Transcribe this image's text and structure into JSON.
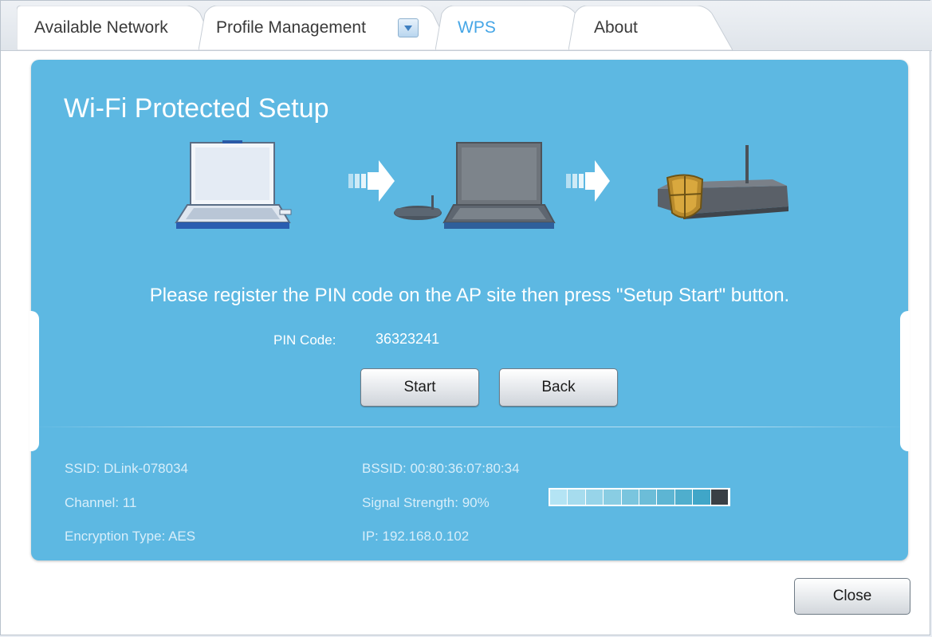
{
  "tabs": [
    {
      "label": "Available Network",
      "active": false
    },
    {
      "label": "Profile Management",
      "active": false
    },
    {
      "label": "WPS",
      "active": true
    },
    {
      "label": "About",
      "active": false
    }
  ],
  "panel": {
    "title": "Wi-Fi Protected Setup",
    "instruction": "Please register the PIN code on the AP site then press \"Setup Start\" button.",
    "pin_label": "PIN Code:",
    "pin_value": "36323241",
    "start_label": "Start",
    "back_label": "Back"
  },
  "status": {
    "ssid": "SSID: DLink-078034",
    "channel": "Channel: 11",
    "encryption": "Encryption Type: AES",
    "bssid": "BSSID: 00:80:36:07:80:34",
    "signal_text": "Signal Strength: 90%",
    "signal_percent": 90,
    "ip": "IP: 192.168.0.102"
  },
  "footer": {
    "close_label": "Close"
  },
  "colors": {
    "panel_bg": "#5db8e2",
    "active_tab_text": "#46a6e6"
  },
  "icons": {
    "tab_dropdown": "chevron-down-icon",
    "step1": "laptop-icon",
    "step2": "laptop-router-icon",
    "step3": "secure-router-icon",
    "arrows": "arrow-right-icon"
  }
}
